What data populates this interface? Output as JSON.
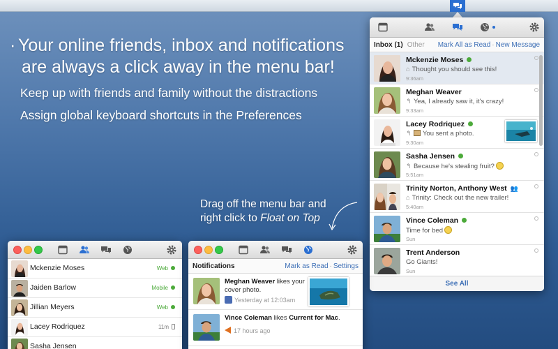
{
  "marketing": {
    "bullet": "·",
    "line1_a": "Your ",
    "line1_b": "online friends",
    "line1_c": ", ",
    "line1_d": "inbox",
    "line1_e": " and ",
    "line1_f": "notifications",
    "line2": "are always a click away in the menu bar!",
    "sub1": "Keep up with friends and family without the distractions",
    "sub2_a": "Assign global keyboard shortcuts in the ",
    "sub2_b": "Preferences",
    "tip_a": "Drag off the menu bar and right click to ",
    "tip_b": "Float on Top"
  },
  "inbox": {
    "tab_label": "Inbox",
    "count": "(1)",
    "other_label": "Other",
    "mark_all": "Mark All as Read",
    "separator": "·",
    "new_message": "New Message",
    "see_all": "See All",
    "messages": [
      {
        "name": "Mckenzie Moses",
        "snippet": "Thought you should see this!",
        "time": "9:36am",
        "online": true
      },
      {
        "name": "Meghan Weaver",
        "snippet": "Yea, I already saw it, it's crazy!",
        "time": "9:33am",
        "online": false
      },
      {
        "name": "Lacey Rodriquez",
        "snippet": "You sent a photo.",
        "time": "9:30am",
        "online": true
      },
      {
        "name": "Sasha Jensen",
        "snippet": "Because he's stealing fruit?",
        "time": "5:51am",
        "online": true
      },
      {
        "name": "Trinity Norton, Anthony West",
        "snippet": "Trinity: Check out the new trailer!",
        "time": "5:40am",
        "online": false
      },
      {
        "name": "Vince Coleman",
        "snippet": "Time for bed",
        "time": "Sun",
        "online": true
      },
      {
        "name": "Trent Anderson",
        "snippet": "Go Giants!",
        "time": "Sun",
        "online": false
      }
    ]
  },
  "friends": [
    {
      "name": "Mckenzie Moses",
      "status": "Web"
    },
    {
      "name": "Jaiden Barlow",
      "status": "Mobile"
    },
    {
      "name": "Jillian Meyers",
      "status": "Web"
    },
    {
      "name": "Lacey Rodriquez",
      "status": "11m"
    },
    {
      "name": "Sasha Jensen",
      "status": ""
    }
  ],
  "notifications": {
    "title": "Notifications",
    "mark_as_read": "Mark as Read",
    "separator": "·",
    "settings": "Settings",
    "items": [
      {
        "actor": "Meghan Weaver",
        "text": " likes your cover photo.",
        "time": "Yesterday at 12:03am"
      },
      {
        "actor": "Vince Coleman",
        "text_a": " likes ",
        "object": "Current for Mac",
        "text_b": ".",
        "time": "17 hours ago"
      }
    ]
  },
  "colors": {
    "accent": "#3d6fb6",
    "online": "#4caa3a",
    "menubar_active": "#2b6fd1"
  }
}
